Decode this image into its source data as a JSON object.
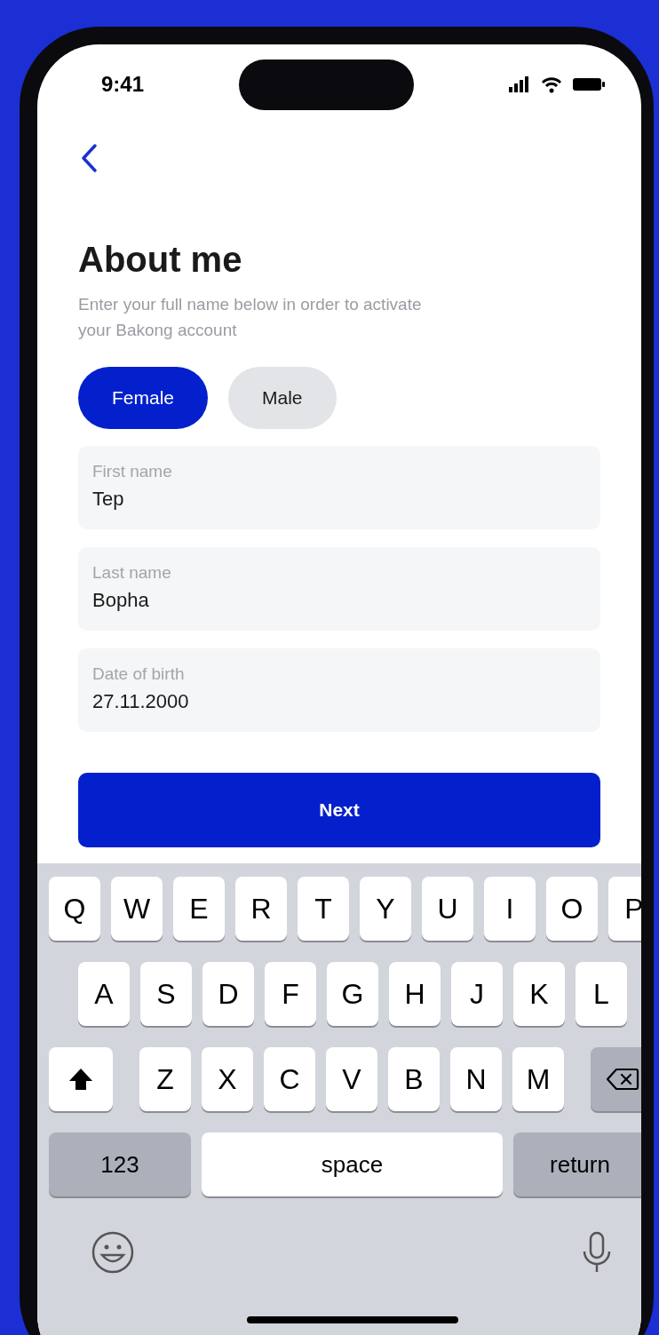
{
  "status_bar": {
    "time": "9:41"
  },
  "title": "About me",
  "subtitle": "Enter your full name below in order to activate your Bakong account",
  "gender_options": [
    {
      "label": "Female",
      "selected": true
    },
    {
      "label": "Male",
      "selected": false
    }
  ],
  "fields": [
    {
      "label": "First name",
      "value": "Tep"
    },
    {
      "label": "Last name",
      "value": "Bopha"
    },
    {
      "label": "Date of birth",
      "value": "27.11.2000"
    }
  ],
  "next_button": "Next",
  "keyboard": {
    "numbers_key": "123",
    "space_key": "space",
    "return_key": "return",
    "letter_rows": [
      [
        {
          "kind": "letter",
          "label": "Q"
        },
        {
          "kind": "letter",
          "label": "W"
        },
        {
          "kind": "letter",
          "label": "E"
        },
        {
          "kind": "letter",
          "label": "R"
        },
        {
          "kind": "letter",
          "label": "T"
        },
        {
          "kind": "letter",
          "label": "Y"
        },
        {
          "kind": "letter",
          "label": "U"
        },
        {
          "kind": "letter",
          "label": "I"
        },
        {
          "kind": "letter",
          "label": "O"
        },
        {
          "kind": "letter",
          "label": "P"
        }
      ],
      [
        {
          "kind": "letter",
          "label": "A"
        },
        {
          "kind": "letter",
          "label": "S"
        },
        {
          "kind": "letter",
          "label": "D"
        },
        {
          "kind": "letter",
          "label": "F"
        },
        {
          "kind": "letter",
          "label": "G"
        },
        {
          "kind": "letter",
          "label": "H"
        },
        {
          "kind": "letter",
          "label": "J"
        },
        {
          "kind": "letter",
          "label": "K"
        },
        {
          "kind": "letter",
          "label": "L"
        }
      ],
      [
        {
          "kind": "shift"
        },
        {
          "kind": "letter",
          "label": "Z"
        },
        {
          "kind": "letter",
          "label": "X"
        },
        {
          "kind": "letter",
          "label": "C"
        },
        {
          "kind": "letter",
          "label": "V"
        },
        {
          "kind": "letter",
          "label": "B"
        },
        {
          "kind": "letter",
          "label": "N"
        },
        {
          "kind": "letter",
          "label": "M"
        },
        {
          "kind": "backspace"
        }
      ]
    ]
  }
}
